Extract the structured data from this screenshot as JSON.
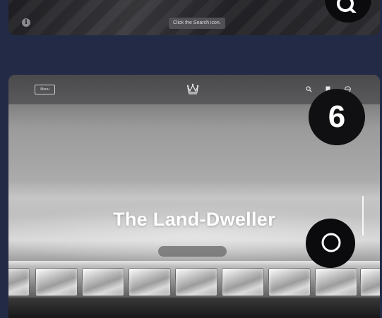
{
  "previous_step": {
    "tooltip": "Click the Search icon.",
    "info_icon": "info-icon",
    "search_icon": "search-icon"
  },
  "main": {
    "step_number": "6",
    "nav": {
      "menu_label": "Menu",
      "logo_icon": "crown-icon",
      "icons": [
        "search-icon",
        "bookmark-icon",
        "globe-icon"
      ]
    },
    "hero": {
      "eyebrow": "",
      "title": "The Land-Dweller",
      "cta_label": ""
    }
  },
  "colors": {
    "background": "#222a45",
    "badge": "#101012"
  }
}
